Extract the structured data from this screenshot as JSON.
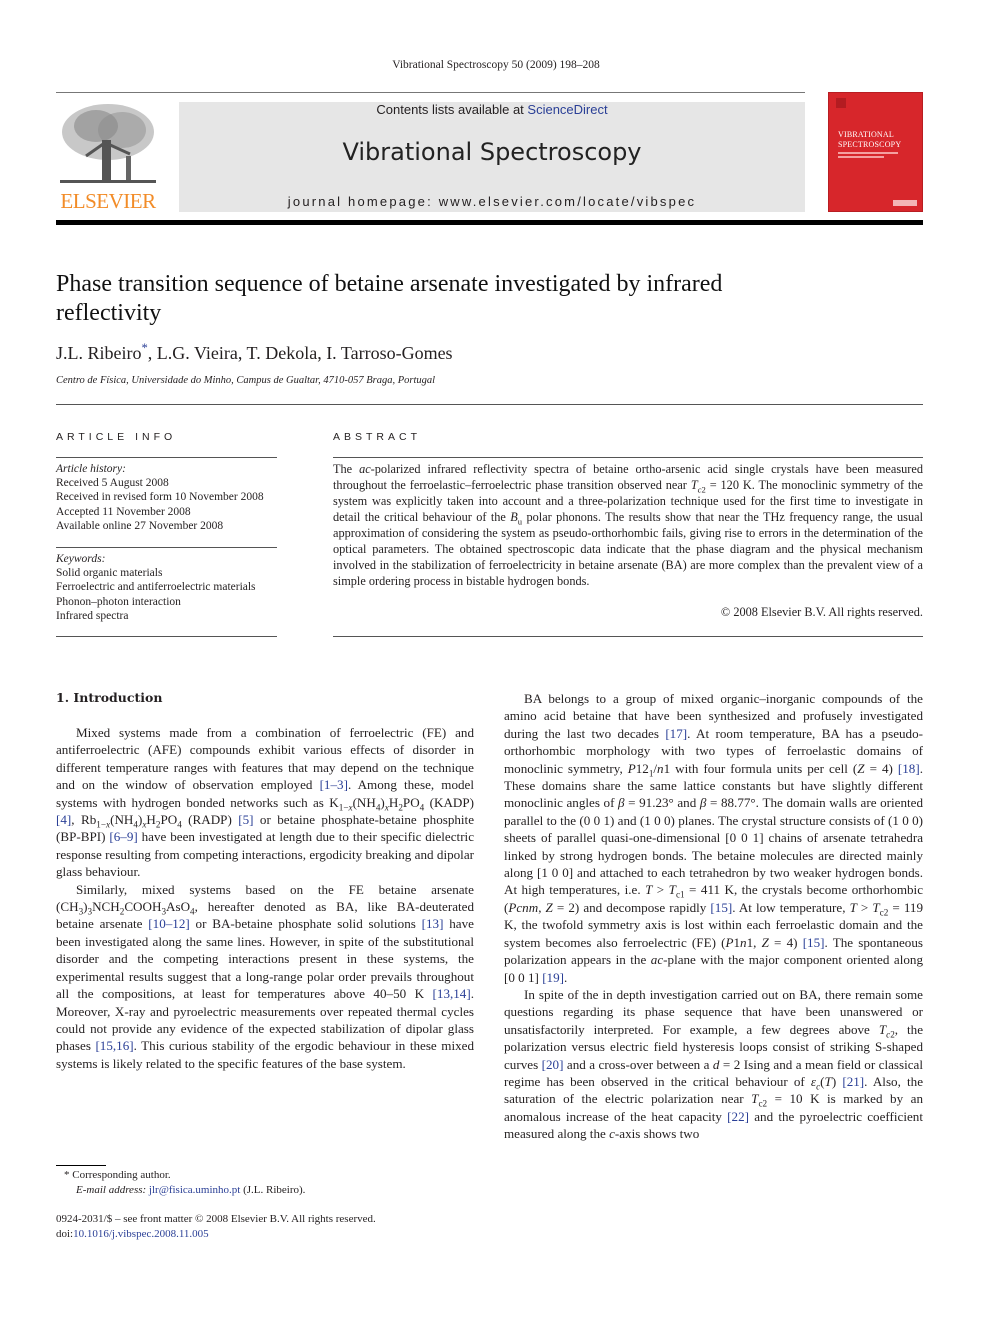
{
  "header": {
    "running_head": "Vibrational Spectroscopy 50 (2009) 198–208",
    "contents_prefix": "Contents lists available at ",
    "contents_link": "ScienceDirect",
    "journal_title": "Vibrational Spectroscopy",
    "homepage": "journal homepage: www.elsevier.com/locate/vibspec",
    "publisher_logo_text": "ELSEVIER",
    "cover": {
      "line1": "VIBRATIONAL",
      "line2": "SPECTROSCOPY",
      "color": "#d7262b"
    },
    "colors": {
      "elsevier_orange": "#f28c28",
      "link_blue": "#2a3f96",
      "banner_gray": "#e6e6e6"
    }
  },
  "article": {
    "title": "Phase transition sequence of betaine arsenate investigated by infrared reflectivity",
    "authors": [
      {
        "name": "J.L. Ribeiro",
        "mark": "*"
      },
      {
        "name": "L.G. Vieira"
      },
      {
        "name": "T. Dekola"
      },
      {
        "name": "I. Tarroso-Gomes"
      }
    ],
    "affiliation": "Centro de Física, Universidade do Minho, Campus de Gualtar, 4710-057 Braga, Portugal"
  },
  "article_info": {
    "heading": "ARTICLE INFO",
    "history_label": "Article history:",
    "history": [
      "Received 5 August 2008",
      "Received in revised form 10 November 2008",
      "Accepted 11 November 2008",
      "Available online 27 November 2008"
    ],
    "keywords_label": "Keywords:",
    "keywords": [
      "Solid organic materials",
      "Ferroelectric and antiferroelectric materials",
      "Phonon–photon interaction",
      "Infrared spectra"
    ]
  },
  "abstract": {
    "heading": "ABSTRACT",
    "copyright": "© 2008 Elsevier B.V. All rights reserved."
  },
  "intro": {
    "heading": "1. Introduction",
    "refs": [
      "[1–3]",
      "[4]",
      "[5]",
      "[6–9]",
      "[10–12]",
      "[13]",
      "[13,14]",
      "[15,16]",
      "[17]",
      "[18]",
      "[15]",
      "[15]",
      "[19]",
      "[20]",
      "[21]",
      "[22]"
    ]
  },
  "footnotes": {
    "corresponding": "Corresponding author.",
    "email_label": "E-mail address:",
    "email": "jlr@fisica.uminho.pt",
    "email_suffix": " (J.L. Ribeiro).",
    "front_matter": "0924-2031/$ – see front matter © 2008 Elsevier B.V. All rights reserved.",
    "doi_prefix": "doi:",
    "doi": "10.1016/j.vibspec.2008.11.005"
  }
}
